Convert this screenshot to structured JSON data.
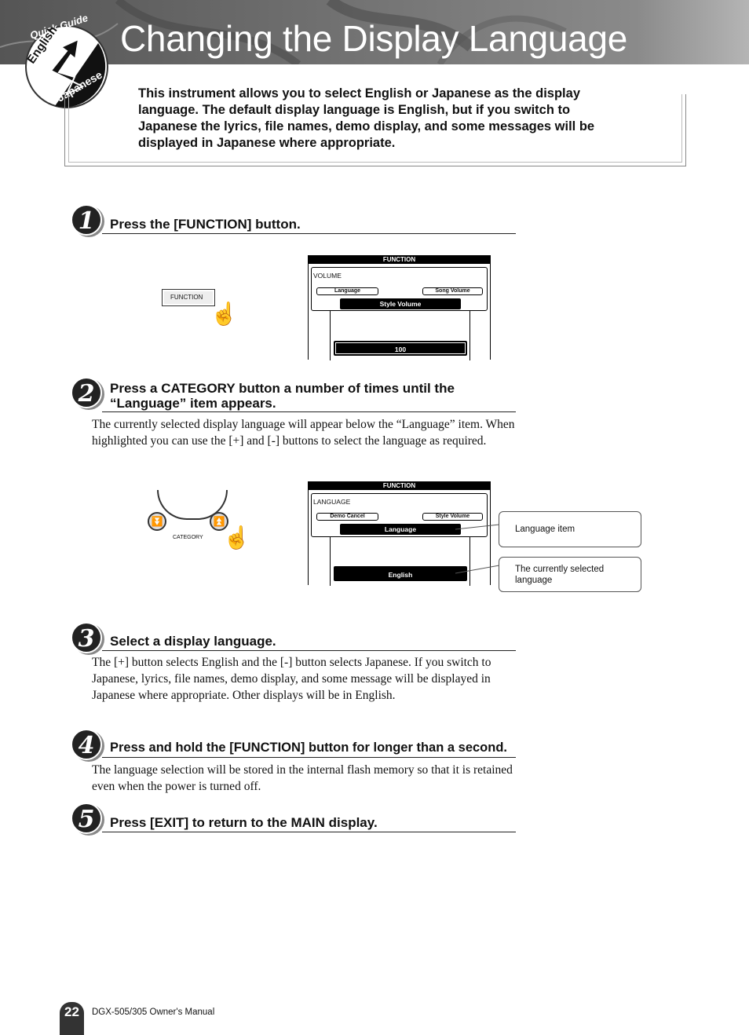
{
  "header": {
    "title": "Changing the Display Language",
    "logo": {
      "top": "Quick Guide",
      "from": "English",
      "to": "Japanese"
    }
  },
  "intro": "This instrument allows you to select English or Japanese as the display language. The default display language is English, but if you switch to Japanese the lyrics, file names, demo display, and some messages will be displayed in Japanese where appropriate.",
  "steps": [
    {
      "number": "1",
      "title": "Press the [FUNCTION] button.",
      "body": ""
    },
    {
      "number": "2",
      "title": "Press a CATEGORY button a number of times until the “Language” item appears.",
      "body": "The currently selected display language will appear below the “Language” item. When highlighted you can use the [+] and [-] buttons to select the language as required."
    },
    {
      "number": "3",
      "title": "Select a display language.",
      "body": "The [+] button selects English and the [-] button selects Japanese. If you switch to Japanese, lyrics, file names, demo display, and some message will be displayed in Japanese where appropriate. Other displays will be in English."
    },
    {
      "number": "4",
      "title": "Press and hold the [FUNCTION] button for longer than a second.",
      "body": "The language selection will be stored in the internal flash memory so that it is retained even when the power is turned off."
    },
    {
      "number": "5",
      "title": "Press [EXIT] to return to the MAIN display.",
      "body": ""
    }
  ],
  "figure1": {
    "button_label": "FUNCTION",
    "lcd": {
      "header": "FUNCTION",
      "group": "VOLUME",
      "prev": "Language",
      "next": "Song Volume",
      "item": "Style Volume",
      "value": "100"
    }
  },
  "figure2": {
    "button_label": "CATEGORY",
    "lcd": {
      "header": "FUNCTION",
      "group": "LANGUAGE",
      "prev": "Demo Cancel",
      "next": "Style Volume",
      "item": "Language",
      "value": "English"
    },
    "callouts": [
      "Language item",
      "The currently selected language"
    ]
  },
  "footer": {
    "page": "22",
    "manual": "DGX-505/305  Owner's Manual"
  }
}
